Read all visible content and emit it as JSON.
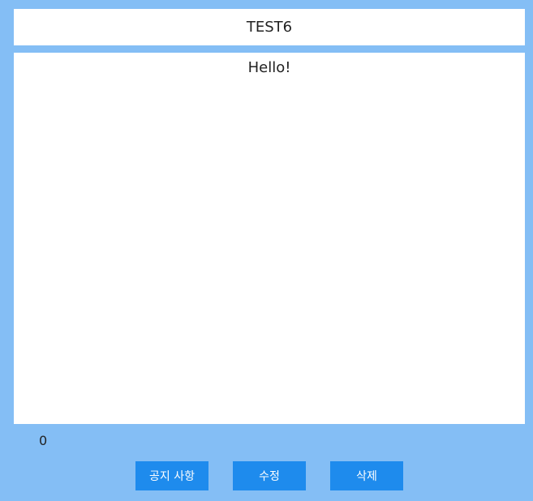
{
  "post": {
    "title": "TEST6",
    "content": "Hello!",
    "count": "0"
  },
  "actions": {
    "notice_label": "공지 사항",
    "edit_label": "수정",
    "delete_label": "삭제"
  },
  "colors": {
    "background": "#84bef5",
    "panel": "#ffffff",
    "button": "#1e8bed",
    "button_text": "#ffffff"
  }
}
